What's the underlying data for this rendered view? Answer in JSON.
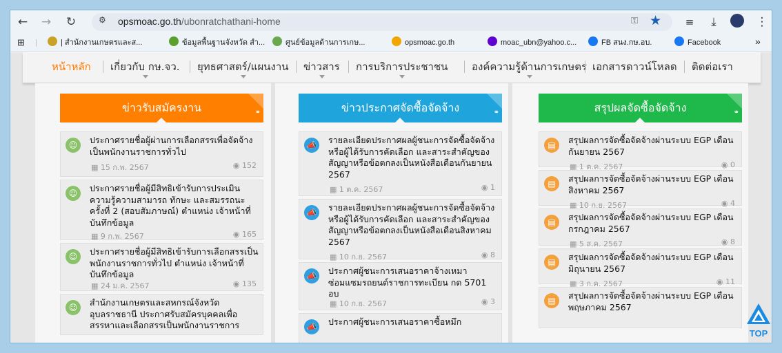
{
  "browser": {
    "url_host": "opsmoac.go.th",
    "url_path": "/ubonratchathani-home",
    "bookmarks": [
      {
        "label": "| สำนักงานเกษตรและส...",
        "color": "#c9a227"
      },
      {
        "label": "ข้อมูลพื้นฐานจังหวัด สำ...",
        "color": "#5aa02c"
      },
      {
        "label": "ศูนย์ข้อมูลด้านการเกษ...",
        "color": "#6aa84f"
      },
      {
        "label": "opsmoac.go.th",
        "color": "#f2a400"
      },
      {
        "label": "moac_ubn@yahoo.c...",
        "color": "#5f01d1"
      },
      {
        "label": "FB สนง.กษ.อบ.",
        "color": "#1877f2"
      },
      {
        "label": "Facebook",
        "color": "#1877f2"
      }
    ],
    "more_label": "»"
  },
  "nav": {
    "items": [
      {
        "label": "หน้าหลัก",
        "active": true,
        "caret": false
      },
      {
        "label": "เกี่ยวกับ กษ.จว.",
        "active": false,
        "caret": true
      },
      {
        "label": "ยุทธศาสตร์/แผนงาน",
        "active": false,
        "caret": true
      },
      {
        "label": "ข่าวสาร",
        "active": false,
        "caret": true
      },
      {
        "label": "การบริการประชาชน",
        "active": false,
        "caret": true
      },
      {
        "label": "องค์ความรู้ด้านการเกษตร",
        "active": false,
        "caret": true
      },
      {
        "label": "เอกสารดาวน์โหลด",
        "active": false,
        "caret": false
      },
      {
        "label": "ติดต่อเรา",
        "active": false,
        "caret": false
      }
    ]
  },
  "panels": [
    {
      "title": "ข่าวรับสมัครงาน",
      "color": "#ff7f00",
      "badge_color": "#8ac26a",
      "items": [
        {
          "title": "ประกาศรายชื่อผู้ผ่านการเลือกสรรเพื่อจัดจ้างเป็นพนักงานราชการทั่วไป",
          "date": "15 ก.พ. 2567",
          "views": "152"
        },
        {
          "title": "ประกาศรายชื่อผู้มีสิทธิเข้ารับการประเมินความรู้ความสามารถ ทักษะ และสมรรถนะ ครั้งที่ 2 (สอบสัมภาษณ์) ตำแหน่ง เจ้าหน้าที่บันทึกข้อมูล",
          "date": "9 ก.พ. 2567",
          "views": "165"
        },
        {
          "title": "ประกาศรายชื่อผู้มีสิทธิเข้ารับการเลือกสรรเป็นพนักงานราชการทั่วไป ตำแหน่ง เจ้าหน้าที่บันทึกข้อมูล",
          "date": "24 ม.ค. 2567",
          "views": "135"
        },
        {
          "title": "สำนักงานเกษตรและสหกรณ์จังหวัดอุบลราชธานี ประกาศรับสมัครบุคคลเพื่อสรรหาและเลือกสรรเป็นพนักงานราชการ",
          "date": "",
          "views": ""
        }
      ]
    },
    {
      "title": "ข่าวประกาศจัดซื้อจัดจ้าง",
      "color": "#1fa5dc",
      "badge_color": "#2f9fe0",
      "items": [
        {
          "title": "รายละเอียดประกาศผลผู้ชนะการจัดซื้อจัดจ้างหรือผู้ได้รับการคัดเลือก และสาระสำคัญของสัญญาหรือข้อตกลงเป็นหนังสือเดือนกันยายน 2567",
          "date": "1 ต.ค. 2567",
          "views": "1"
        },
        {
          "title": "รายละเอียดประกาศผลผู้ชนะการจัดซื้อจัดจ้างหรือผู้ได้รับการคัดเลือก และสาระสำคัญของสัญญาหรือข้อตกลงเป็นหนังสือเดือนสิงหาคม 2567",
          "date": "10 ก.ย. 2567",
          "views": "8"
        },
        {
          "title": "ประกาศผู้ชนะการเสนอราคาจ้างเหมาซ่อมแซมรถยนต์ราชการทะเบียน กด 5701 อบ",
          "date": "10 ก.ย. 2567",
          "views": "3"
        },
        {
          "title": "ประกาศผู้ชนะการเสนอราคาซื้อหมึก",
          "date": "",
          "views": ""
        }
      ]
    },
    {
      "title": "สรุปผลจัดซื้อจัดจ้าง",
      "color": "#1fb84a",
      "badge_color": "#f4a03c",
      "items": [
        {
          "title": "สรุปผลการจัดซื้อจัดจ้างผ่านระบบ EGP เดือนกันยายน 2567",
          "date": "1 ต.ค. 2567",
          "views": "0"
        },
        {
          "title": "สรุปผลการจัดซื้อจัดจ้างผ่านระบบ EGP เดือนสิงหาคม 2567",
          "date": "10 ก.ย. 2567",
          "views": "4"
        },
        {
          "title": "สรุปผลการจัดซื้อจัดจ้างผ่านระบบ EGP เดือนกรกฎาคม 2567",
          "date": "5 ส.ค. 2567",
          "views": "8"
        },
        {
          "title": "สรุปผลการจัดซื้อจัดจ้างผ่านระบบ EGP เดือนมิถุนายน 2567",
          "date": "3 ก.ค. 2567",
          "views": "11"
        },
        {
          "title": "สรุปผลการจัดซื้อจัดจ้างผ่านระบบ EGP เดือนพฤษภาคม 2567",
          "date": "",
          "views": ""
        }
      ]
    }
  ],
  "top_button": {
    "label": "TOP"
  }
}
